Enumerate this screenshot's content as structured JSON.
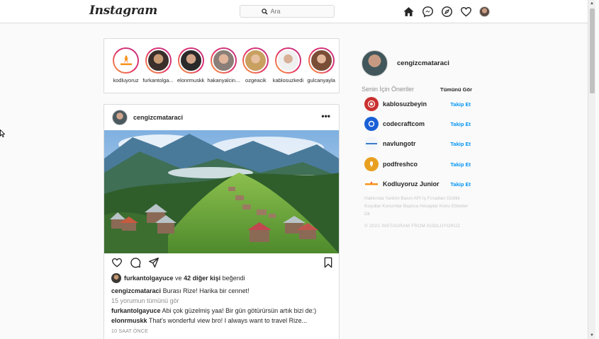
{
  "header": {
    "logo": "Instagram",
    "search_placeholder": "Ara",
    "icons": [
      "home-icon",
      "messenger-icon",
      "explore-icon",
      "heart-icon",
      "avatar"
    ]
  },
  "stories": [
    {
      "name": "kodluyoruz"
    },
    {
      "name": "furkantolga..."
    },
    {
      "name": "elonrmuskk"
    },
    {
      "name": "hakanyalcin..."
    },
    {
      "name": "ozgeacik"
    },
    {
      "name": "kablosuzkedi"
    },
    {
      "name": "gulcanyayla"
    }
  ],
  "post": {
    "username": "cengizcmataraci",
    "menu": "•••",
    "liked_by_user": "furkantolgayuce",
    "liked_and": "ve",
    "liked_others": "42 diğer kişi",
    "liked_suffix": "beğendi",
    "caption_user": "cengizcmataraci",
    "caption_text": "Burası Rize! Harika bir cennet!",
    "view_comments": "15 yorumun tümünü gör",
    "comments": [
      {
        "user": "furkantolgayuce",
        "text": "Abi çok güzelmiş yaa! Bir gün götürürsün artık bizi de:)"
      },
      {
        "user": "elonrmuskk",
        "text": "That's wonderful view bro! I always want to travel Rize..."
      }
    ],
    "time": "10 SAAT ÖNCE"
  },
  "sidebar": {
    "username": "cengizcmataraci",
    "suggestions_title": "Senin İçin Öneriler",
    "see_all": "Tümünü Gör",
    "suggestions": [
      {
        "name": "kablosuzbeyin",
        "follow": "Takip Et"
      },
      {
        "name": "codecraftcom",
        "follow": "Takip Et"
      },
      {
        "name": "navlungotr",
        "follow": "Takip Et"
      },
      {
        "name": "podfreshco",
        "follow": "Takip Et"
      },
      {
        "name": "Kodluyoruz Junior",
        "follow": "Takip Et"
      }
    ],
    "footer_links": "Hakkında Yardım Basın API İş Fırsatları Gizlilik Koşullar Konumlar Başlıca Hesaplar Konu Etiketler Dil",
    "copyright": "© 2021 INSTAGRAM FROM KODLUYORUZ"
  },
  "colors": {
    "accent": "#0095f6",
    "border": "#dbdbdb",
    "background": "#fafafa",
    "muted": "#8e8e8e"
  }
}
